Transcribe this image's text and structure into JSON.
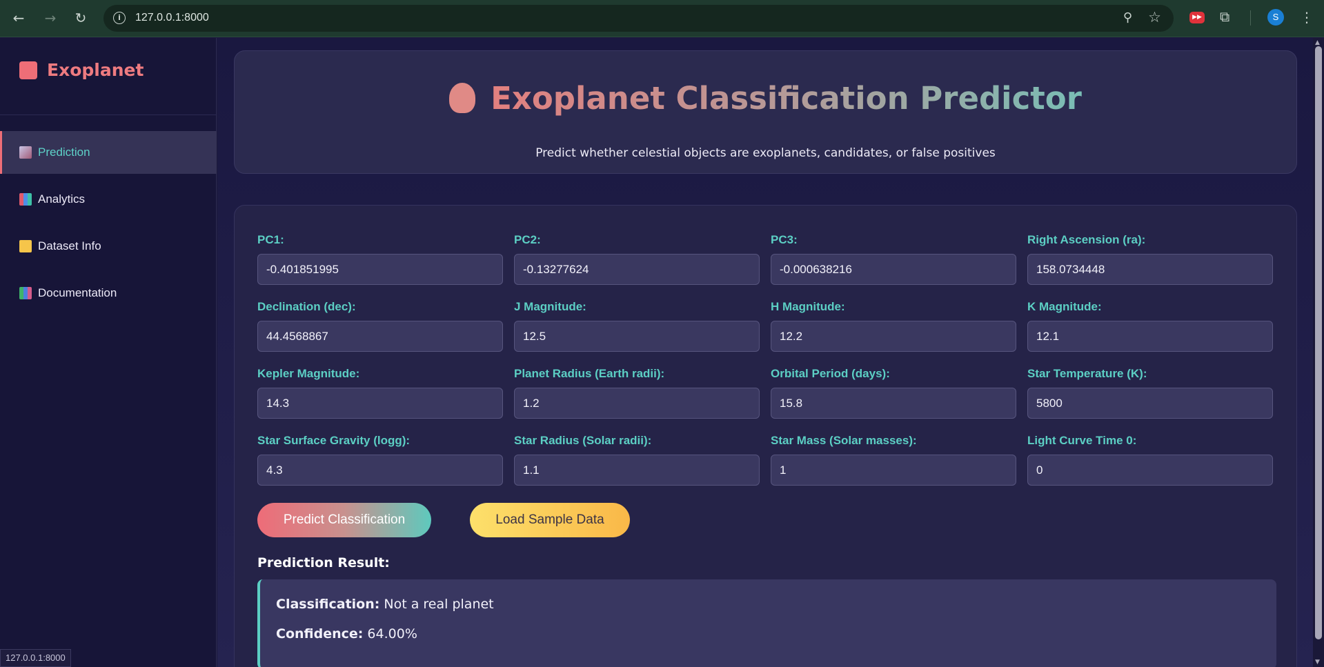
{
  "browser": {
    "url": "127.0.0.1:8000",
    "profile_initial": "S",
    "status_url": "127.0.0.1:8000"
  },
  "sidebar": {
    "brand": "Exoplanet",
    "items": [
      {
        "label": "Prediction",
        "icon": "telescope-icon",
        "active": true
      },
      {
        "label": "Analytics",
        "icon": "bar-chart-icon",
        "active": false
      },
      {
        "label": "Dataset Info",
        "icon": "folder-icon",
        "active": false
      },
      {
        "label": "Documentation",
        "icon": "books-icon",
        "active": false
      }
    ]
  },
  "hero": {
    "title": "Exoplanet Classification Predictor",
    "subtitle": "Predict whether celestial objects are exoplanets, candidates, or false positives"
  },
  "form": {
    "fields": [
      {
        "label": "PC1:",
        "value": "-0.401851995"
      },
      {
        "label": "PC2:",
        "value": "-0.13277624"
      },
      {
        "label": "PC3:",
        "value": "-0.000638216"
      },
      {
        "label": "Right Ascension (ra):",
        "value": "158.0734448"
      },
      {
        "label": "Declination (dec):",
        "value": "44.4568867"
      },
      {
        "label": "J Magnitude:",
        "value": "12.5"
      },
      {
        "label": "H Magnitude:",
        "value": "12.2"
      },
      {
        "label": "K Magnitude:",
        "value": "12.1"
      },
      {
        "label": "Kepler Magnitude:",
        "value": "14.3"
      },
      {
        "label": "Planet Radius (Earth radii):",
        "value": "1.2"
      },
      {
        "label": "Orbital Period (days):",
        "value": "15.8"
      },
      {
        "label": "Star Temperature (K):",
        "value": "5800"
      },
      {
        "label": "Star Surface Gravity (logg):",
        "value": "4.3"
      },
      {
        "label": "Star Radius (Solar radii):",
        "value": "1.1"
      },
      {
        "label": "Star Mass (Solar masses):",
        "value": "1"
      },
      {
        "label": "Light Curve Time 0:",
        "value": "0"
      }
    ],
    "predict_label": "Predict Classification",
    "sample_label": "Load Sample Data"
  },
  "result": {
    "heading": "Prediction Result:",
    "classification_label": "Classification:",
    "classification_value": "Not a real planet",
    "confidence_label": "Confidence:",
    "confidence_value": "64.00%"
  },
  "colors": {
    "accent_coral": "#ee6e77",
    "accent_teal": "#5ccfc4",
    "accent_yellow": "#fde06b"
  }
}
